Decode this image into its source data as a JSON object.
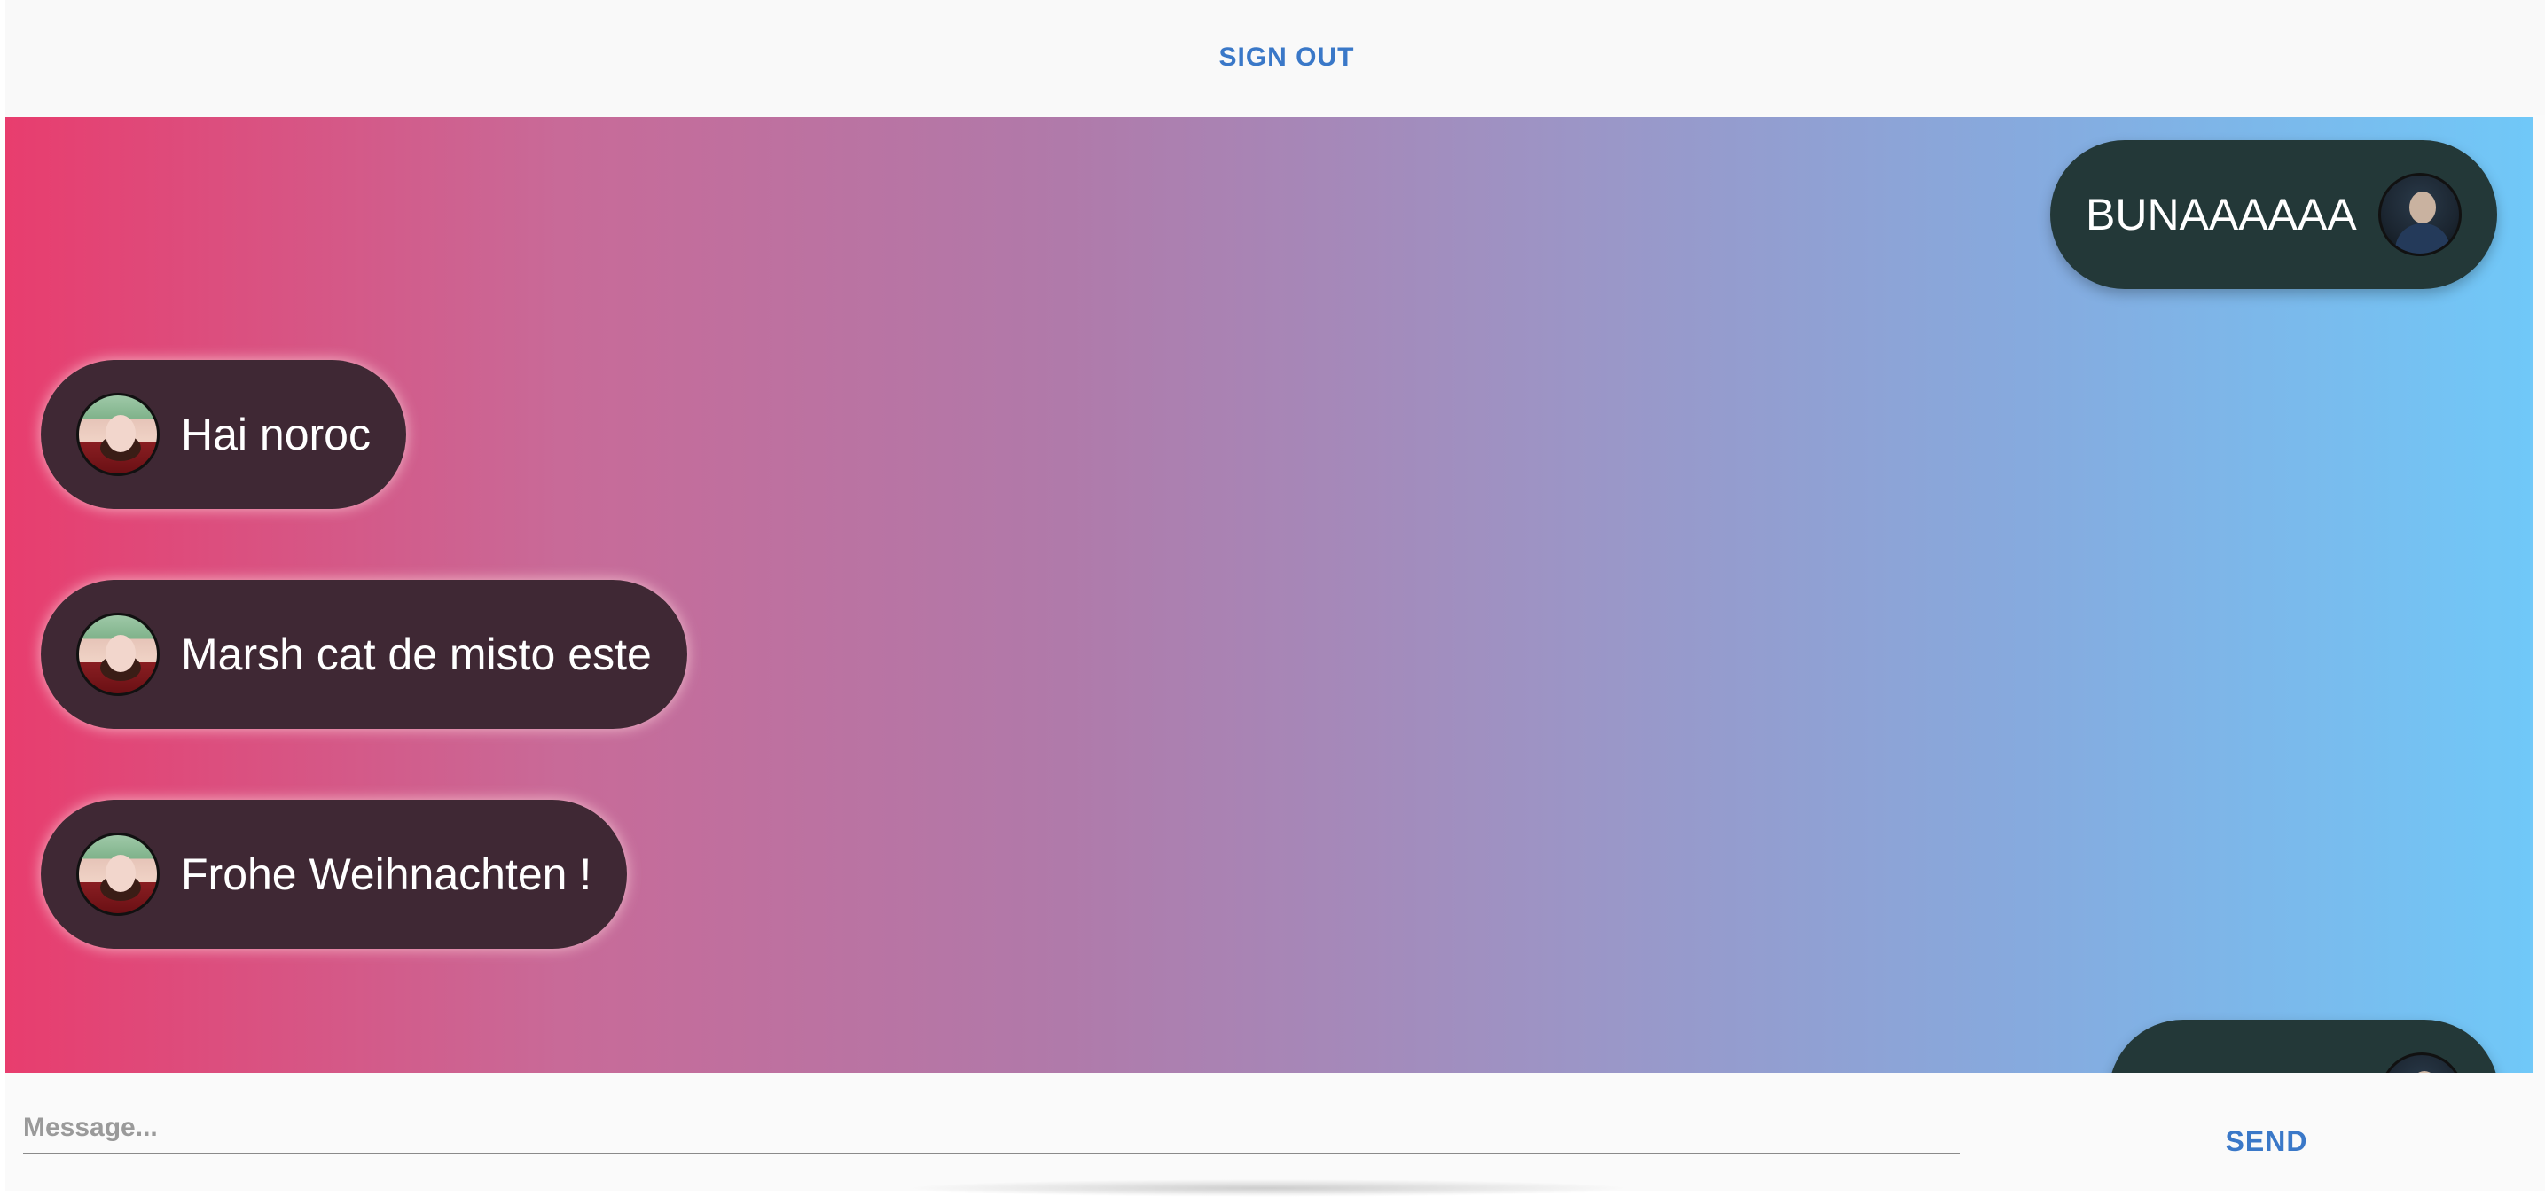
{
  "header": {
    "sign_out_label": "SIGN OUT"
  },
  "chat": {
    "messages": [
      {
        "text": "BUNAAAAAA",
        "direction": "sent",
        "avatar": "male-avatar"
      },
      {
        "text": "Hai noroc",
        "direction": "received",
        "avatar": "female-avatar"
      },
      {
        "text": "Marsh cat de misto este",
        "direction": "received",
        "avatar": "female-avatar"
      },
      {
        "text": "Frohe Weihnachten !",
        "direction": "received",
        "avatar": "female-avatar"
      },
      {
        "text": "",
        "direction": "sent",
        "avatar": "male-avatar"
      }
    ],
    "colors": {
      "gradient_start": "#e83d6e",
      "gradient_end": "#70c8f8",
      "received_bubble": "#3f2834",
      "sent_bubble": "#233838"
    }
  },
  "composer": {
    "placeholder": "Message...",
    "value": "",
    "send_label": "SEND",
    "accent": "#3a78c8"
  }
}
